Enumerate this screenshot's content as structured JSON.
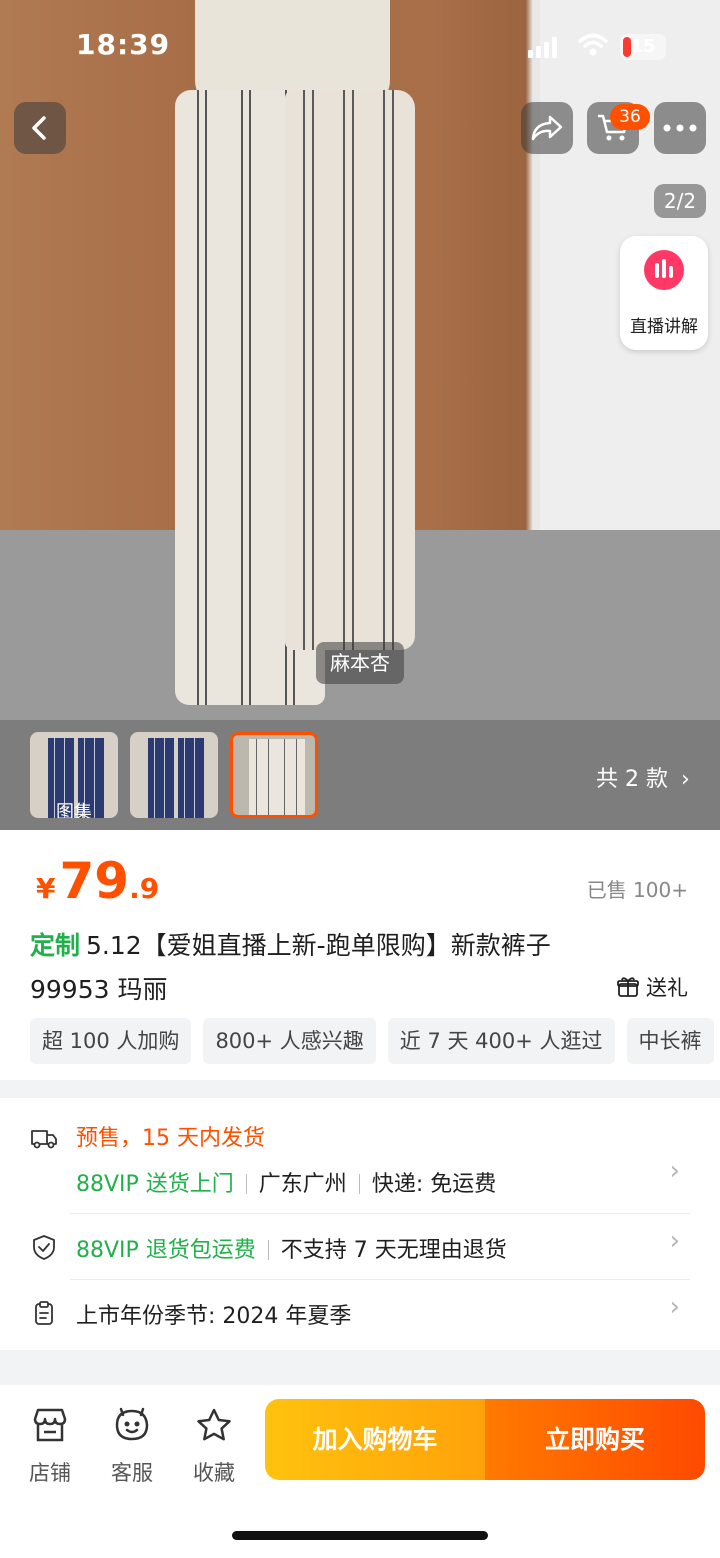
{
  "status_bar": {
    "time": "18:39",
    "battery": "15"
  },
  "nav": {
    "cart_badge": "36",
    "image_counter": "2/2",
    "live_label": "直播讲解"
  },
  "hero": {
    "brand_tag": "麻本杏"
  },
  "thumbnails": {
    "gallery_label": "图集",
    "styles_count": "共 2 款"
  },
  "product": {
    "currency": "¥",
    "price_int": "79",
    "price_dec": ".9",
    "sold": "已售 100+",
    "title_tag": "定制",
    "title": "5.12【爱姐直播上新-跑单限购】新款裤子 99953 玛丽",
    "gift": "送礼",
    "chips": [
      "超 100 人加购",
      "800+ 人感兴趣",
      "近 7 天 400+ 人逛过",
      "中长裤"
    ]
  },
  "service": {
    "presale": "预售，15 天内发货",
    "delivery_vip": "88VIP 送货上门",
    "origin": "广东广州",
    "shipping": "快递: 免运费",
    "return_vip": "88VIP 退货包运费",
    "return_policy": "不支持 7 天无理由退货",
    "season": "上市年份季节: 2024 年夏季"
  },
  "bottom_bar": {
    "store": "店铺",
    "service": "客服",
    "favorite": "收藏",
    "add_to_cart": "加入购物车",
    "buy_now": "立即购买"
  },
  "colors": {
    "accent": "#ff5000",
    "green": "#21b04a",
    "cart_btn": "#ffb20c",
    "buy_btn": "#ff5a00"
  }
}
